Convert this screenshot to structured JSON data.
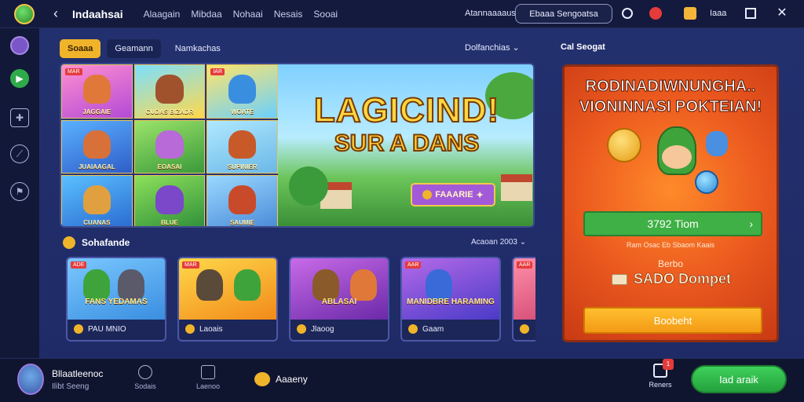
{
  "topbar": {
    "title": "Indaahsai",
    "nav": [
      "Alaagain",
      "Mibdaa",
      "Nohaai",
      "Nesais",
      "Sooai"
    ],
    "account_label": "Atannaaaaus",
    "search_text": "Ebaaa Sengoatsa",
    "right_text": "Iaaa"
  },
  "tabs": {
    "active": "Soaaa",
    "second": "Geamann",
    "third": "Namkachas"
  },
  "sort_label": "Dolfanchias",
  "right_heading": "Cal Seogat",
  "hero": {
    "title": "LAGICIND!",
    "subtitle": "SUR A DANS",
    "cta_label": "FAAARIE",
    "thumbnails": [
      {
        "tag": "MAR",
        "label": "JAGGAIE"
      },
      {
        "tag": "",
        "label": "CUDAS BIZADR"
      },
      {
        "tag": "IAR",
        "label": "WOATE"
      },
      {
        "tag": "",
        "label": "JUAIAAGAL"
      },
      {
        "tag": "",
        "label": "EOASAI"
      },
      {
        "tag": "",
        "label": "SUPINIER"
      },
      {
        "tag": "",
        "label": "CUANAS"
      },
      {
        "tag": "",
        "label": "BLUE"
      },
      {
        "tag": "",
        "label": "SAUMIE"
      }
    ]
  },
  "section": {
    "title": "Sohafande",
    "more_label": "Acaoan 2003"
  },
  "cards": [
    {
      "badge": "ADE",
      "title": "FANS YEDAMAS",
      "footer": "PAU MNIO",
      "color": "#5aa2e8"
    },
    {
      "badge": "MAR",
      "title": "",
      "footer": "Laoais",
      "color": "#f2b33a"
    },
    {
      "badge": "",
      "title": "ABLASAI",
      "footer": "Jlaoog",
      "color": "#8a4ac8"
    },
    {
      "badge": "AAR",
      "title": "MANIDBRE HARAMING",
      "footer": "Gaam",
      "color": "#7a5ae0"
    },
    {
      "badge": "AAR",
      "title": "",
      "footer": "",
      "color": "#e85a7a"
    }
  ],
  "promo": {
    "title_line1": "RODINADIWNUNGHA..",
    "title_line2": "VIONINNASI POKTEIAN!",
    "button1_label": "3792 Tiom",
    "small_text": "Ram Osac Eb Sbaom Kaais",
    "label": "Berbo",
    "big_text": "SADO Dompet",
    "button2_label": "Boobeht"
  },
  "bottombar": {
    "user_name": "Bllaatleenoc",
    "user_sub": "Ilibt Seeng",
    "nav": [
      {
        "label": "Sodais"
      },
      {
        "label": "Laenoo"
      }
    ],
    "wallet_label": "Aaaeny",
    "inbox_label": "Reners",
    "inbox_count": "1",
    "play_label": "Iad araik"
  }
}
